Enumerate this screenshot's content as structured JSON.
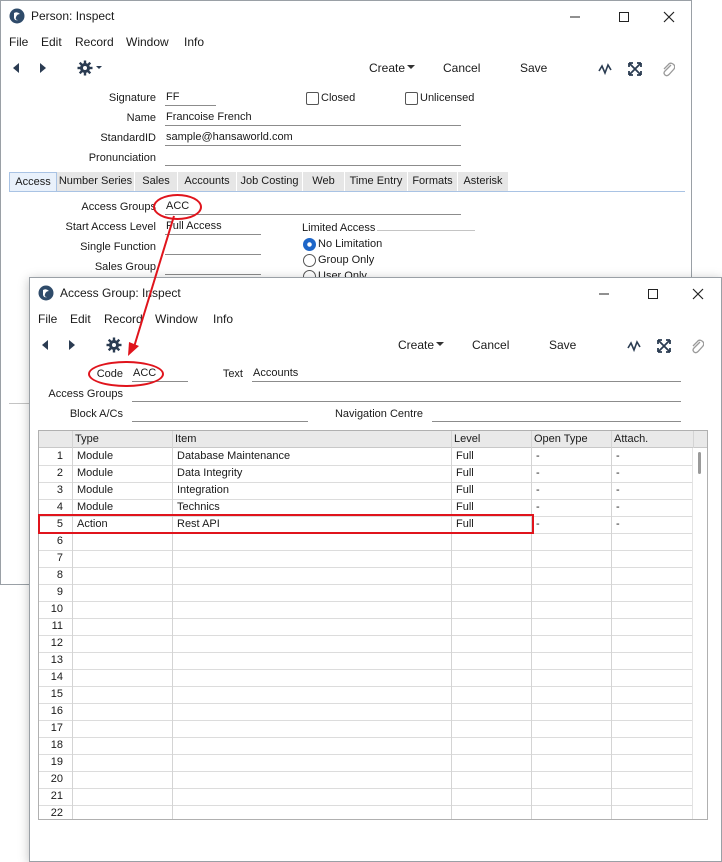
{
  "win1": {
    "title": "Person: Inspect",
    "menu": [
      "File",
      "Edit",
      "Record",
      "Window",
      "Info"
    ],
    "toolbar": {
      "create": "Create",
      "cancel": "Cancel",
      "save": "Save"
    },
    "form": {
      "signature_label": "Signature",
      "signature": "FF",
      "closed_label": "Closed",
      "unlicensed_label": "Unlicensed",
      "name_label": "Name",
      "name": "Francoise French",
      "standardid_label": "StandardID",
      "standardid": "sample@hansaworld.com",
      "pronunciation_label": "Pronunciation",
      "pronunciation": ""
    },
    "tabs": [
      "Access",
      "Number Series",
      "Sales",
      "Accounts",
      "Job Costing",
      "Web",
      "Time Entry",
      "Formats",
      "Asterisk"
    ],
    "access": {
      "access_groups_label": "Access Groups",
      "access_groups": "ACC",
      "start_level_label": "Start Access Level",
      "start_level": "Full Access",
      "single_function_label": "Single Function",
      "single_function": "",
      "sales_group_label": "Sales Group",
      "sales_group": "",
      "limited_access_label": "Limited Access",
      "opt_no_limitation": "No Limitation",
      "opt_group_only": "Group Only",
      "opt_user_only": "User Only"
    }
  },
  "win2": {
    "title": "Access Group: Inspect",
    "menu": [
      "File",
      "Edit",
      "Record",
      "Window",
      "Info"
    ],
    "toolbar": {
      "create": "Create",
      "cancel": "Cancel",
      "save": "Save"
    },
    "form": {
      "code_label": "Code",
      "code": "ACC",
      "text_label": "Text",
      "text": "Accounts",
      "access_groups_label": "Access Groups",
      "access_groups": "",
      "block_label": "Block A/Cs",
      "block": "",
      "nav_label": "Navigation Centre",
      "nav": ""
    },
    "grid": {
      "headers": [
        "Type",
        "Item",
        "Level",
        "Open Type",
        "Attach."
      ],
      "rows": [
        {
          "n": "1",
          "type": "Module",
          "item": "Database Maintenance",
          "level": "Full",
          "open": "-",
          "attach": "-"
        },
        {
          "n": "2",
          "type": "Module",
          "item": "Data Integrity",
          "level": "Full",
          "open": "-",
          "attach": "-"
        },
        {
          "n": "3",
          "type": "Module",
          "item": "Integration",
          "level": "Full",
          "open": "-",
          "attach": "-"
        },
        {
          "n": "4",
          "type": "Module",
          "item": "Technics",
          "level": "Full",
          "open": "-",
          "attach": "-"
        },
        {
          "n": "5",
          "type": "Action",
          "item": "Rest API",
          "level": "Full",
          "open": "-",
          "attach": "-"
        },
        {
          "n": "6"
        },
        {
          "n": "7"
        },
        {
          "n": "8"
        },
        {
          "n": "9"
        },
        {
          "n": "10"
        },
        {
          "n": "11"
        },
        {
          "n": "12"
        },
        {
          "n": "13"
        },
        {
          "n": "14"
        },
        {
          "n": "15"
        },
        {
          "n": "16"
        },
        {
          "n": "17"
        },
        {
          "n": "18"
        },
        {
          "n": "19"
        },
        {
          "n": "20"
        },
        {
          "n": "21"
        },
        {
          "n": "22"
        }
      ]
    }
  },
  "colors": {
    "annotation": "#e0141c",
    "accent": "#1e66c8"
  }
}
